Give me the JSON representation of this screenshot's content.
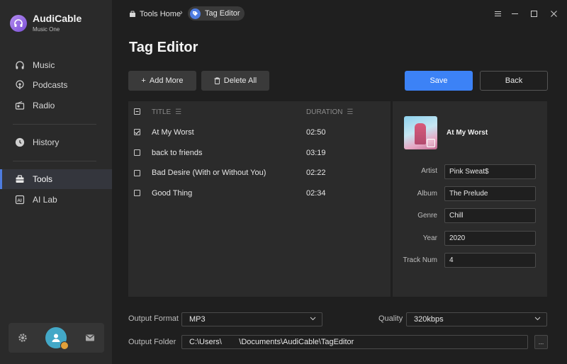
{
  "app": {
    "name": "AudiCable",
    "subtitle": "Music One"
  },
  "sidebar": {
    "items": [
      {
        "label": "Music",
        "icon": "headphones-icon"
      },
      {
        "label": "Podcasts",
        "icon": "podcast-icon"
      },
      {
        "label": "Radio",
        "icon": "radio-icon"
      },
      {
        "label": "History",
        "icon": "clock-icon"
      },
      {
        "label": "Tools",
        "icon": "toolbox-icon",
        "active": true
      },
      {
        "label": "AI Lab",
        "icon": "ai-lab-icon"
      }
    ],
    "bottom": [
      "gear-icon",
      "user-avatar",
      "mail-icon"
    ]
  },
  "breadcrumb": {
    "home": "Tools Home",
    "current": "Tag Editor"
  },
  "page": {
    "title": "Tag Editor"
  },
  "toolbar": {
    "add_more": "Add More",
    "delete_all": "Delete All",
    "save": "Save",
    "back": "Back"
  },
  "table": {
    "headers": {
      "title": "TITLE",
      "duration": "DURATION"
    },
    "rows": [
      {
        "title": "At My Worst",
        "duration": "02:50",
        "checked": true
      },
      {
        "title": "back to friends",
        "duration": "03:19",
        "checked": false
      },
      {
        "title": "Bad Desire (With or Without You)",
        "duration": "02:22",
        "checked": false
      },
      {
        "title": "Good Thing",
        "duration": "02:34",
        "checked": false
      }
    ]
  },
  "tags": {
    "song_title": "At My Worst",
    "fields": [
      {
        "label": "Artist",
        "value": "Pink Sweat$"
      },
      {
        "label": "Album",
        "value": "The Prelude"
      },
      {
        "label": "Genre",
        "value": "Chill"
      },
      {
        "label": "Year",
        "value": "2020"
      },
      {
        "label": "Track Num",
        "value": "4"
      }
    ]
  },
  "output": {
    "format_label": "Output Format",
    "format_value": "MP3",
    "quality_label": "Quality",
    "quality_value": "320kbps",
    "folder_label": "Output Folder",
    "folder_value": "C:\\Users\\        \\Documents\\AudiCable\\TagEditor",
    "browse_label": "..."
  },
  "colors": {
    "accent": "#3c82f6",
    "background": "#1f1f1f",
    "panel": "#2b2b2b",
    "sidebar": "#2a2a2a"
  }
}
